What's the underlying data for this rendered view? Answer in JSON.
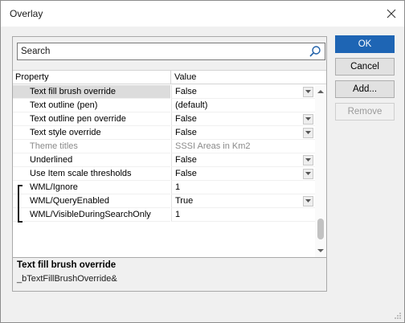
{
  "window": {
    "title": "Overlay"
  },
  "search": {
    "placeholder": "Search"
  },
  "grid": {
    "header": {
      "property": "Property",
      "value": "Value"
    },
    "rows": [
      {
        "property": "Text fill brush override",
        "value": "False",
        "dropdown": true,
        "selected": true,
        "dim": false
      },
      {
        "property": "Text outline (pen)",
        "value": "(default)",
        "dropdown": false,
        "selected": false,
        "dim": false
      },
      {
        "property": "Text outline pen override",
        "value": "False",
        "dropdown": true,
        "selected": false,
        "dim": false
      },
      {
        "property": "Text style override",
        "value": "False",
        "dropdown": true,
        "selected": false,
        "dim": false
      },
      {
        "property": "Theme titles",
        "value": "SSSI Areas in Km2",
        "dropdown": false,
        "selected": false,
        "dim": true
      },
      {
        "property": "Underlined",
        "value": "False",
        "dropdown": true,
        "selected": false,
        "dim": false
      },
      {
        "property": "Use Item scale thresholds",
        "value": "False",
        "dropdown": true,
        "selected": false,
        "dim": false
      },
      {
        "property": "WML/Ignore",
        "value": "1",
        "dropdown": false,
        "selected": false,
        "dim": false
      },
      {
        "property": "WML/QueryEnabled",
        "value": "True",
        "dropdown": true,
        "selected": false,
        "dim": false
      },
      {
        "property": "WML/VisibleDuringSearchOnly",
        "value": "1",
        "dropdown": false,
        "selected": false,
        "dim": false
      }
    ]
  },
  "description": {
    "title": "Text fill brush override",
    "text": "_bTextFillBrushOverride&"
  },
  "buttons": {
    "ok": "OK",
    "cancel": "Cancel",
    "add": "Add...",
    "remove": "Remove"
  },
  "colors": {
    "primary_button": "#1e65b4",
    "selected_row": "#dcdcdc"
  }
}
